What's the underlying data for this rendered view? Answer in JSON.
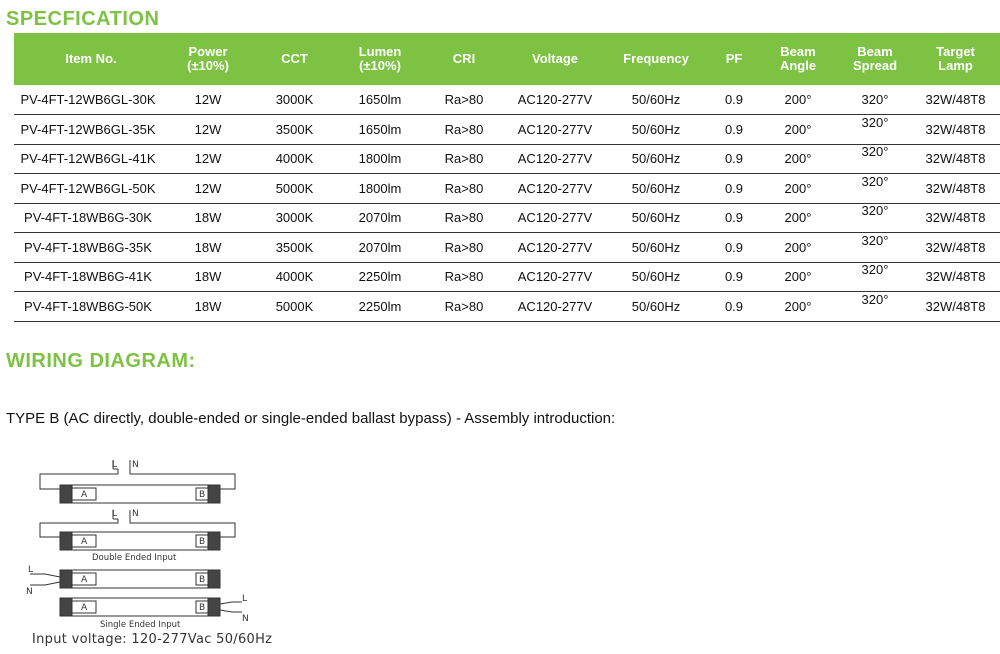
{
  "spec_title": "SPECFICATION",
  "columns": [
    {
      "line1": "Item No.",
      "line2": ""
    },
    {
      "line1": "Power",
      "line2": "(±10%)"
    },
    {
      "line1": "CCT",
      "line2": ""
    },
    {
      "line1": "Lumen",
      "line2": "(±10%)"
    },
    {
      "line1": "CRI",
      "line2": ""
    },
    {
      "line1": "Voltage",
      "line2": ""
    },
    {
      "line1": "Frequency",
      "line2": ""
    },
    {
      "line1": "PF",
      "line2": ""
    },
    {
      "line1": "Beam",
      "line2": "Angle"
    },
    {
      "line1": "Beam",
      "line2": "Spread"
    },
    {
      "line1": "Target",
      "line2": "Lamp"
    }
  ],
  "rows": [
    [
      "PV-4FT-12WB6GL-30K",
      "12W",
      "3000K",
      "1650lm",
      "Ra>80",
      "AC120-277V",
      "50/60Hz",
      "0.9",
      "200°",
      "320°",
      "32W/48T8"
    ],
    [
      "PV-4FT-12WB6GL-35K",
      "12W",
      "3500K",
      "1650lm",
      "Ra>80",
      "AC120-277V",
      "50/60Hz",
      "0.9",
      "200°",
      "320°",
      "32W/48T8"
    ],
    [
      "PV-4FT-12WB6GL-41K",
      "12W",
      "4000K",
      "1800lm",
      "Ra>80",
      "AC120-277V",
      "50/60Hz",
      "0.9",
      "200°",
      "320°",
      "32W/48T8"
    ],
    [
      "PV-4FT-12WB6GL-50K",
      "12W",
      "5000K",
      "1800lm",
      "Ra>80",
      "AC120-277V",
      "50/60Hz",
      "0.9",
      "200°",
      "320°",
      "32W/48T8"
    ],
    [
      "PV-4FT-18WB6G-30K",
      "18W",
      "3000K",
      "2070lm",
      "Ra>80",
      "AC120-277V",
      "50/60Hz",
      "0.9",
      "200°",
      "320°",
      "32W/48T8"
    ],
    [
      "PV-4FT-18WB6G-35K",
      "18W",
      "3500K",
      "2070lm",
      "Ra>80",
      "AC120-277V",
      "50/60Hz",
      "0.9",
      "200°",
      "320°",
      "32W/48T8"
    ],
    [
      "PV-4FT-18WB6G-41K",
      "18W",
      "4000K",
      "2250lm",
      "Ra>80",
      "AC120-277V",
      "50/60Hz",
      "0.9",
      "200°",
      "320°",
      "32W/48T8"
    ],
    [
      "PV-4FT-18WB6G-50K",
      "18W",
      "5000K",
      "2250lm",
      "Ra>80",
      "AC120-277V",
      "50/60Hz",
      "0.9",
      "200°",
      "320°",
      "32W/48T8"
    ]
  ],
  "wiring_title": "WIRING DIAGRAM:",
  "type_line": "TYPE B (AC directly, double-ended or single-ended ballast bypass) - Assembly introduction:",
  "diagram": {
    "label_L": "L",
    "label_N": "N",
    "end_A": "A",
    "end_B": "B",
    "double_caption": "Double Ended Input",
    "single_caption": "Single Ended Input"
  },
  "input_voltage": "Input voltage: 120-277Vac 50/60Hz",
  "colors": {
    "accent": "#7dc242"
  }
}
